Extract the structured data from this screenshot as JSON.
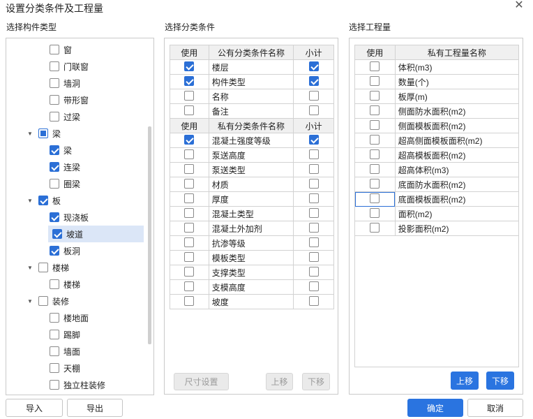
{
  "window": {
    "title": "设置分类条件及工程量",
    "close_icon": "close-icon"
  },
  "left": {
    "label": "选择构件类型",
    "tree": [
      {
        "label": "窗",
        "checked": "none",
        "level": 1
      },
      {
        "label": "门联窗",
        "checked": "none",
        "level": 1
      },
      {
        "label": "墙洞",
        "checked": "none",
        "level": 1
      },
      {
        "label": "带形窗",
        "checked": "none",
        "level": 1
      },
      {
        "label": "过梁",
        "checked": "none",
        "level": 1
      },
      {
        "label": "梁",
        "checked": "partial",
        "level": 0,
        "expanded": true
      },
      {
        "label": "梁",
        "checked": "checked",
        "level": 1
      },
      {
        "label": "连梁",
        "checked": "checked",
        "level": 1
      },
      {
        "label": "圈梁",
        "checked": "none",
        "level": 1
      },
      {
        "label": "板",
        "checked": "checked",
        "level": 0,
        "expanded": true
      },
      {
        "label": "现浇板",
        "checked": "checked",
        "level": 1
      },
      {
        "label": "坡道",
        "checked": "checked",
        "level": 1,
        "selected": true
      },
      {
        "label": "板洞",
        "checked": "checked",
        "level": 1
      },
      {
        "label": "楼梯",
        "checked": "none",
        "level": 0,
        "expanded": true
      },
      {
        "label": "楼梯",
        "checked": "none",
        "level": 1
      },
      {
        "label": "装修",
        "checked": "none",
        "level": 0,
        "expanded": true
      },
      {
        "label": "楼地面",
        "checked": "none",
        "level": 1
      },
      {
        "label": "踢脚",
        "checked": "none",
        "level": 1
      },
      {
        "label": "墙面",
        "checked": "none",
        "level": 1
      },
      {
        "label": "天棚",
        "checked": "none",
        "level": 1
      },
      {
        "label": "独立柱装修",
        "checked": "none",
        "level": 1
      }
    ],
    "import_label": "导入",
    "export_label": "导出"
  },
  "middle": {
    "label": "选择分类条件",
    "public_header": {
      "use": "使用",
      "name": "公有分类条件名称",
      "subtotal": "小计"
    },
    "public_rows": [
      {
        "name": "楼层",
        "use": true,
        "subtotal": true
      },
      {
        "name": "构件类型",
        "use": true,
        "subtotal": true
      },
      {
        "name": "名称",
        "use": false,
        "subtotal": false
      },
      {
        "name": "备注",
        "use": false,
        "subtotal": false
      }
    ],
    "private_header": {
      "use": "使用",
      "name": "私有分类条件名称",
      "subtotal": "小计"
    },
    "private_rows": [
      {
        "name": "混凝土强度等级",
        "use": true,
        "subtotal": true
      },
      {
        "name": "泵送高度",
        "use": false,
        "subtotal": false
      },
      {
        "name": "泵送类型",
        "use": false,
        "subtotal": false
      },
      {
        "name": "材质",
        "use": false,
        "subtotal": false
      },
      {
        "name": "厚度",
        "use": false,
        "subtotal": false
      },
      {
        "name": "混凝土类型",
        "use": false,
        "subtotal": false
      },
      {
        "name": "混凝土外加剂",
        "use": false,
        "subtotal": false
      },
      {
        "name": "抗渗等级",
        "use": false,
        "subtotal": false
      },
      {
        "name": "模板类型",
        "use": false,
        "subtotal": false
      },
      {
        "name": "支撑类型",
        "use": false,
        "subtotal": false
      },
      {
        "name": "支模高度",
        "use": false,
        "subtotal": false
      },
      {
        "name": "坡度",
        "use": false,
        "subtotal": false
      }
    ],
    "size_button": "尺寸设置",
    "up_button": "上移",
    "down_button": "下移"
  },
  "right": {
    "label": "选择工程量",
    "header": {
      "use": "使用",
      "name": "私有工程量名称"
    },
    "rows": [
      {
        "name": "体积(m3)",
        "use": false
      },
      {
        "name": "数量(个)",
        "use": false
      },
      {
        "name": "板厚(m)",
        "use": false
      },
      {
        "name": "侧面防水面积(m2)",
        "use": false
      },
      {
        "name": "侧面模板面积(m2)",
        "use": false
      },
      {
        "name": "超高侧面模板面积(m2)",
        "use": false
      },
      {
        "name": "超高模板面积(m2)",
        "use": false
      },
      {
        "name": "超高体积(m3)",
        "use": false
      },
      {
        "name": "底面防水面积(m2)",
        "use": false
      },
      {
        "name": "底面模板面积(m2)",
        "use": false,
        "focused": true
      },
      {
        "name": "面积(m2)",
        "use": false
      },
      {
        "name": "投影面积(m2)",
        "use": false
      }
    ],
    "up_button": "上移",
    "down_button": "下移"
  },
  "footer": {
    "ok_label": "确定",
    "cancel_label": "取消"
  },
  "colors": {
    "accent": "#2a74e0",
    "selection": "#dbe6f7"
  }
}
